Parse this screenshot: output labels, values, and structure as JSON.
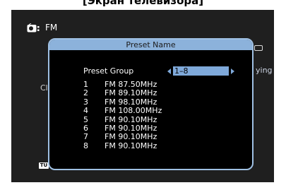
{
  "caption": "[Экран телевизора]",
  "source": {
    "icon": "tuner-icon",
    "label": "FM"
  },
  "background_text": {
    "left": "Cl",
    "right": "ying"
  },
  "dialog": {
    "title": "Preset Name",
    "group_label": "Preset Group",
    "group_value": "1–8",
    "presets": [
      {
        "num": "1",
        "freq": "FM 87.50MHz"
      },
      {
        "num": "2",
        "freq": "FM 89.10MHz"
      },
      {
        "num": "3",
        "freq": "FM 98.10MHz"
      },
      {
        "num": "4",
        "freq": "FM 108.00MHz"
      },
      {
        "num": "5",
        "freq": "FM 90.10MHz"
      },
      {
        "num": "6",
        "freq": "FM 90.10MHz"
      },
      {
        "num": "7",
        "freq": "FM 90.10MHz"
      },
      {
        "num": "8",
        "freq": "FM 90.10MHz"
      }
    ]
  },
  "tu_badge": "TU",
  "colors": {
    "header": "#8cb2db",
    "accent": "#7fa9da",
    "screen": "#1f1f1f"
  }
}
